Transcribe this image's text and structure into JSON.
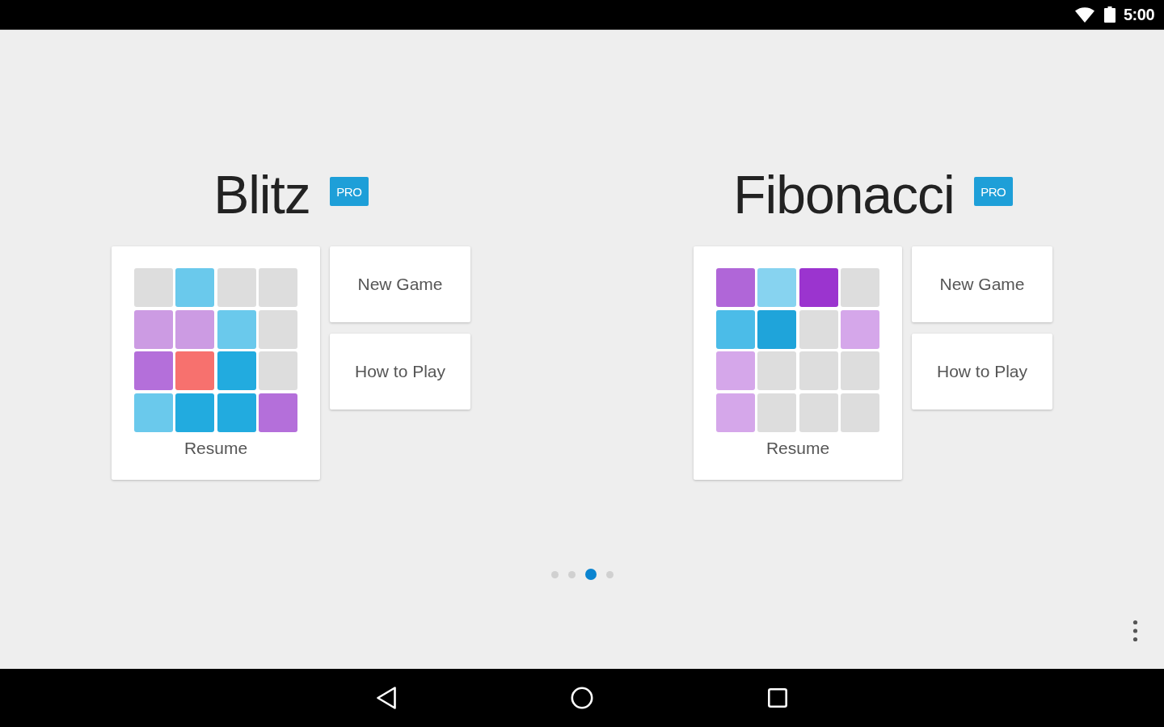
{
  "status_bar": {
    "time": "5:00"
  },
  "games": [
    {
      "title": "Blitz",
      "badge": "PRO",
      "resume": {
        "label": "Resume",
        "tiles": [
          {
            "color": "#dddddd"
          },
          {
            "color": "#6ac9ec"
          },
          {
            "color": "#dddddd"
          },
          {
            "color": "#dddddd"
          },
          {
            "color": "#cc9be3"
          },
          {
            "color": "#cc9be3"
          },
          {
            "color": "#6ac9ec"
          },
          {
            "color": "#dddddd"
          },
          {
            "color": "#b46fda"
          },
          {
            "color": "#f7716e"
          },
          {
            "color": "#22abdf"
          },
          {
            "color": "#dddddd"
          },
          {
            "color": "#6ac9ec"
          },
          {
            "color": "#22abdf"
          },
          {
            "color": "#22abdf"
          },
          {
            "color": "#b46fda"
          }
        ]
      },
      "buttons": [
        "New Game",
        "How to Play"
      ]
    },
    {
      "title": "Fibonacci",
      "badge": "PRO",
      "resume": {
        "label": "Resume",
        "tiles": [
          {
            "color": "#b066d8"
          },
          {
            "color": "#87d3f0"
          },
          {
            "color": "#9b34cf"
          },
          {
            "color": "#dddddd"
          },
          {
            "color": "#4bbce8"
          },
          {
            "color": "#1fa4da"
          },
          {
            "color": "#dddddd"
          },
          {
            "color": "#d5a7ea"
          },
          {
            "color": "#d5a7ea"
          },
          {
            "color": "#dddddd"
          },
          {
            "color": "#dddddd"
          },
          {
            "color": "#dddddd"
          },
          {
            "color": "#d5a7ea"
          },
          {
            "color": "#dddddd"
          },
          {
            "color": "#dddddd"
          },
          {
            "color": "#dddddd"
          }
        ]
      },
      "buttons": [
        "New Game",
        "How to Play"
      ]
    }
  ],
  "page_indicator": [
    {
      "selected": false
    },
    {
      "selected": false
    },
    {
      "selected": true
    },
    {
      "selected": false
    }
  ]
}
